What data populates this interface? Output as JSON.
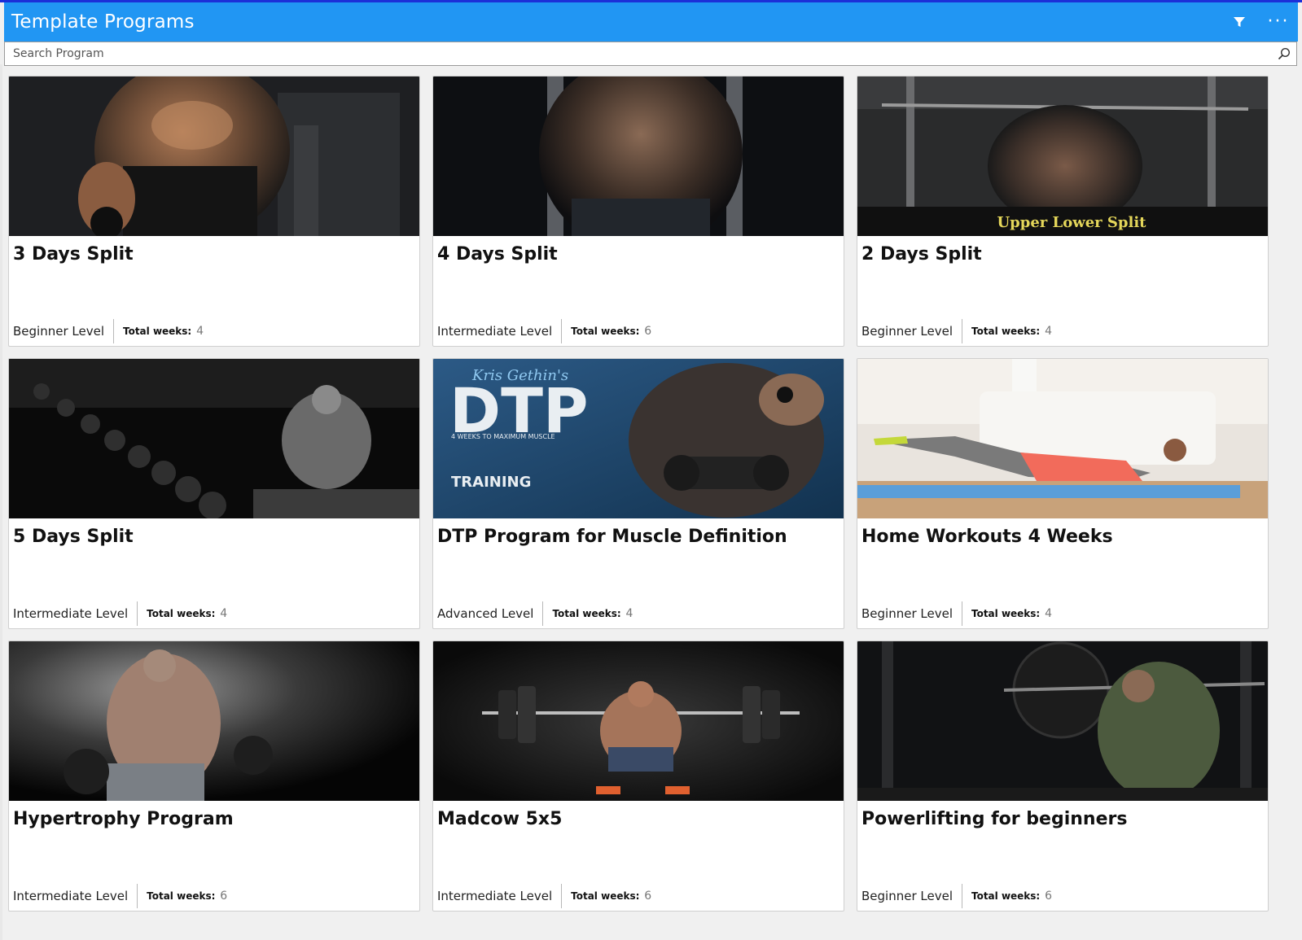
{
  "app": {
    "title": "Template Programs"
  },
  "toolbar": {
    "filter_icon": "filter-icon",
    "more_icon": "more-icon",
    "more_label": "···"
  },
  "search": {
    "placeholder": "Search Program",
    "value": "",
    "icon": "search-icon"
  },
  "labels": {
    "total_weeks": "Total weeks:"
  },
  "programs": [
    {
      "title": "3 Days Split",
      "level": "Beginner Level",
      "weeks": "4",
      "image": "shirtless-bodybuilder-gym"
    },
    {
      "title": "4 Days Split",
      "level": "Intermediate Level",
      "weeks": "6",
      "image": "muscular-back-dark"
    },
    {
      "title": "2 Days Split",
      "level": "Beginner Level",
      "weeks": "4",
      "image": "lat-pulldown-back",
      "image_caption": "Upper Lower Split"
    },
    {
      "title": "5 Days Split",
      "level": "Intermediate Level",
      "weeks": "4",
      "image": "dumbbell-rack-seated-man"
    },
    {
      "title": "DTP Program for Muscle Definition",
      "level": "Advanced Level",
      "weeks": "4",
      "image": "dtp-training-banner",
      "image_signature": "Kris Gethin's",
      "image_logo": "DTP",
      "image_tagline": "4 WEEKS TO MAXIMUM MUSCLE",
      "image_caption": "TRAINING"
    },
    {
      "title": "Home Workouts 4 Weeks",
      "level": "Beginner Level",
      "weeks": "4",
      "image": "woman-pushup-home"
    },
    {
      "title": "Hypertrophy Program",
      "level": "Intermediate Level",
      "weeks": "6",
      "image": "bodybuilder-dumbbells-smoke"
    },
    {
      "title": "Madcow 5x5",
      "level": "Intermediate Level",
      "weeks": "6",
      "image": "barbell-squat-dark"
    },
    {
      "title": "Powerlifting for beginners",
      "level": "Beginner Level",
      "weeks": "6",
      "image": "barbell-back-squat-rack"
    }
  ],
  "colors": {
    "header": "#2196f3",
    "accent": "#1c2fd8"
  }
}
